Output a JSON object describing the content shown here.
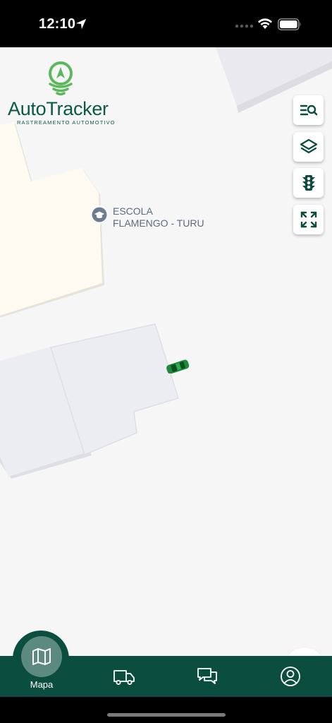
{
  "status_bar": {
    "time": "12:10",
    "icons": [
      "location-arrow-icon",
      "cellular-signal-icon",
      "wifi-icon",
      "battery-icon"
    ]
  },
  "logo": {
    "name": "AutoTracker",
    "tagline": "RASTREAMENTO AUTOMOTIVO",
    "brand_green": "#0b5a47",
    "accent_green": "#5cb85c"
  },
  "map": {
    "poi": {
      "icon": "school-cap-icon",
      "label_line1": "ESCOLA",
      "label_line2": "FLAMENGO - TURU"
    },
    "vehicle_icon": "green-car-icon",
    "controls": [
      {
        "name": "search-list-button",
        "icon": "search-list-icon"
      },
      {
        "name": "layers-button",
        "icon": "layers-icon"
      },
      {
        "name": "traffic-button",
        "icon": "traffic-light-icon"
      },
      {
        "name": "fullscreen-button",
        "icon": "expand-icon"
      }
    ]
  },
  "tabbar": {
    "background": "#0b4d3f",
    "tabs": [
      {
        "label": "Mapa",
        "icon": "map-icon",
        "active": true
      },
      {
        "label": "",
        "icon": "truck-icon",
        "active": false
      },
      {
        "label": "",
        "icon": "chat-icon",
        "active": false
      },
      {
        "label": "",
        "icon": "user-icon",
        "active": false
      }
    ]
  }
}
